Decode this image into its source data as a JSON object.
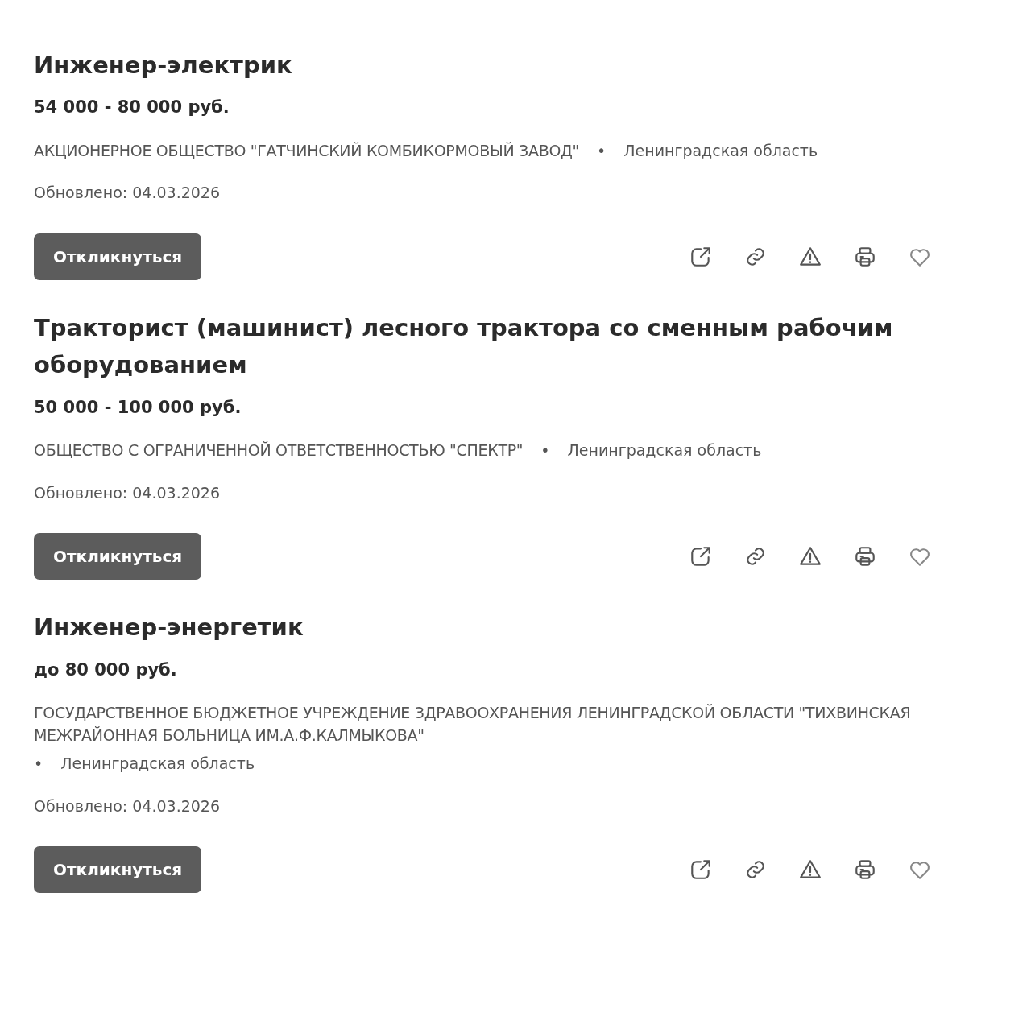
{
  "vacancies": [
    {
      "title": "Инженер-электрик",
      "salary": "54 000 - 80 000 руб.",
      "employer": "АКЦИОНЕРНОЕ ОБЩЕСТВО \"ГАТЧИНСКИЙ КОМБИКОРМОВЫЙ ЗАВОД\"",
      "separator": "•",
      "region": "Ленинградская область",
      "updated": "Обновлено: 04.03.2026",
      "button": "Откликнуться"
    },
    {
      "title": "Тракторист (машинист) лесного трактора со сменным рабочим оборудованием",
      "salary": "50 000 - 100 000 руб.",
      "employer": "ОБЩЕСТВО С ОГРАНИЧЕННОЙ ОТВЕТСТВЕННОСТЬЮ \"СПЕКТР\"",
      "separator": "•",
      "region": "Ленинградская область",
      "updated": "Обновлено: 04.03.2026",
      "button": "Откликнуться"
    },
    {
      "title": "Инженер-энергетик",
      "salary": "до 80 000 руб.",
      "employer": "ГОСУДАРСТВЕННОЕ БЮДЖЕТНОЕ УЧРЕЖДЕНИЕ ЗДРАВООХРАНЕНИЯ ЛЕНИНГРАДСКОЙ ОБЛАСТИ \"ТИХВИНСКАЯ МЕЖРАЙОННАЯ БОЛЬНИЦА ИМ.А.Ф.КАЛМЫКОВА\"",
      "separator": "•",
      "region": "Ленинградская область",
      "updated": "Обновлено: 04.03.2026",
      "button": "Откликнуться"
    }
  ]
}
